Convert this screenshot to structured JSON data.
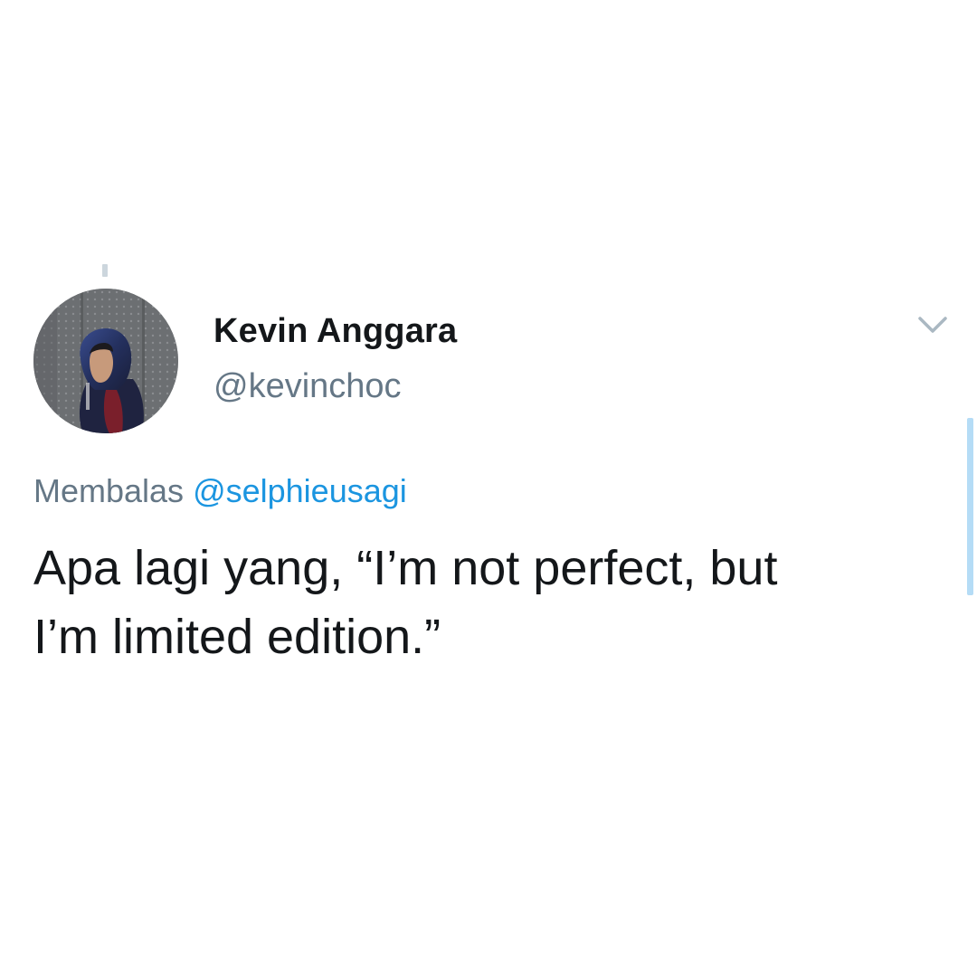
{
  "tweet": {
    "author": {
      "display_name": "Kevin Anggara",
      "handle": "@kevinchoc",
      "avatar_icon": "profile-photo-hooded-person"
    },
    "reply": {
      "prefix": "Membalas",
      "mention": "@selphieusagi"
    },
    "text_lines": [
      "Apa lagi yang, “I’m not perfect, but",
      "I’m limited edition.”"
    ],
    "menu_icon": "chevron-down-icon"
  },
  "colors": {
    "text_primary": "#14171a",
    "text_secondary": "#657786",
    "link": "#1b95e0",
    "caret": "#aab8c2",
    "scroll_indicator": "#b5dcf6"
  }
}
